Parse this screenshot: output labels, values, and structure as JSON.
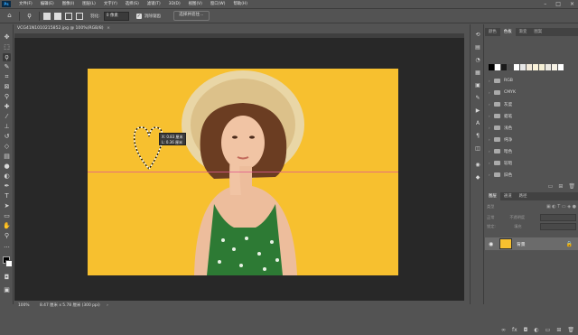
{
  "menubar": {
    "items": [
      "文件(F)",
      "编辑(E)",
      "图像(I)",
      "图层(L)",
      "文字(Y)",
      "选择(S)",
      "滤镜(T)",
      "3D(D)",
      "视图(V)",
      "窗口(W)",
      "帮助(H)"
    ]
  },
  "options": {
    "feather_label": "羽化:",
    "feather_value": "0 像素",
    "antialias_label": "消除锯齿",
    "select_mask_button": "选择并遮住..."
  },
  "doc_tab": {
    "title": "VCG41N1010215852.jpg @ 100%(RGB/8)",
    "close": "×"
  },
  "tooltip": {
    "line1": "X: 0.83 厘米",
    "line2": "L: 0.36 厘米"
  },
  "status": {
    "zoom": "100%",
    "size": "8.47 厘米 x 5.78 厘米 (300 ppi)",
    "arrow": "›"
  },
  "swatches_panel": {
    "tabs": [
      "颜色",
      "色板",
      "渐变",
      "图案"
    ],
    "active_tab": 1,
    "swatch_colors": [
      "#000000",
      "#ffffff",
      "#1a1a1a",
      "#4d4d4d",
      "#ffffff",
      "#e6e6e6",
      "#f2e9d8",
      "#fbf3da",
      "#f5efd5",
      "#ece9e2",
      "#f7f3e6",
      "#ffffff"
    ],
    "groups": [
      "RGB",
      "CMYK",
      "灰度",
      "蜡笔",
      "浅色",
      "纯净",
      "暗色",
      "较暗",
      "旧色"
    ]
  },
  "layers_panel": {
    "tabs": [
      "图层",
      "通道",
      "路径"
    ],
    "active_tab": 0,
    "kind_label": "类型",
    "mode_label": "正常",
    "opacity_label": "不透明度",
    "lock_label": "锁定:",
    "fill_label": "填充",
    "layer_name": "背景"
  }
}
